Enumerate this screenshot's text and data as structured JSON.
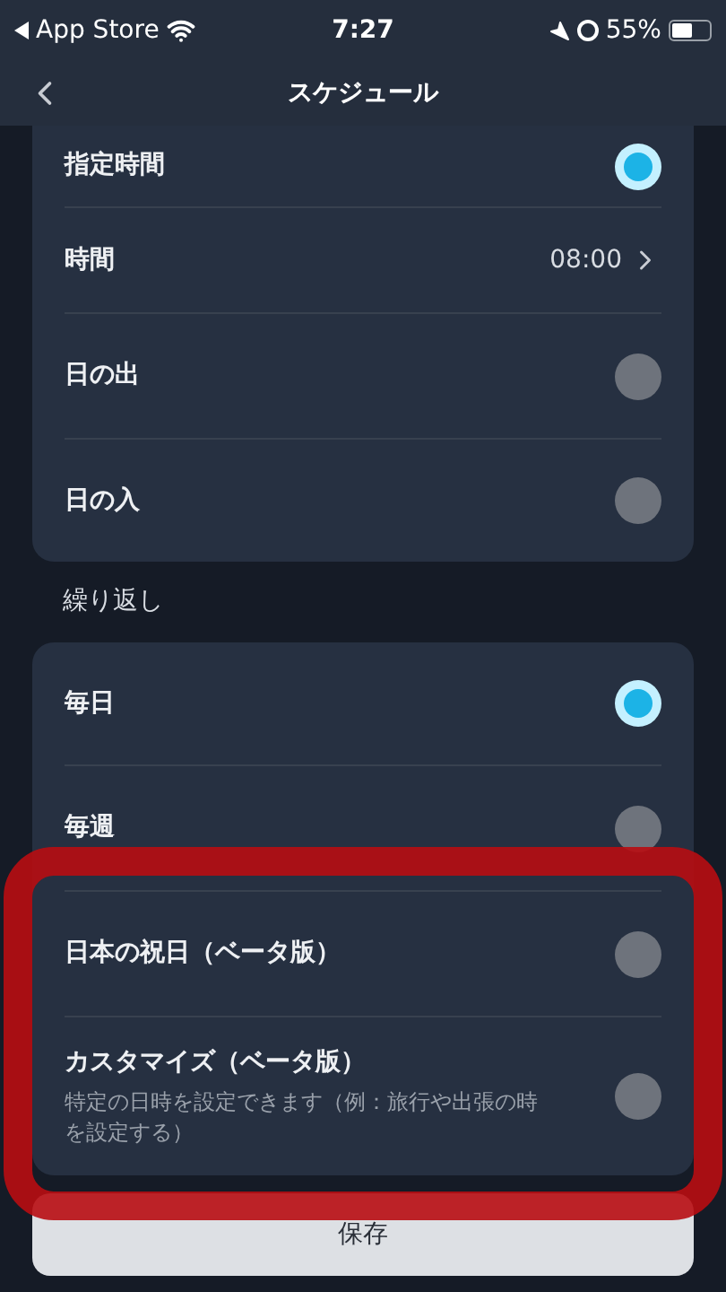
{
  "status_bar": {
    "back_app": "App Store",
    "time": "7:27",
    "battery": "55%"
  },
  "nav_bar": {
    "title": "スケジュール"
  },
  "sections": [
    {
      "items": [
        {
          "kind": "radio",
          "label": "指定時間",
          "selected": true
        },
        {
          "kind": "value",
          "label": "時間",
          "value": "08:00"
        },
        {
          "kind": "radio",
          "label": "日の出",
          "selected": false
        },
        {
          "kind": "radio",
          "label": "日の入",
          "selected": false
        }
      ]
    },
    {
      "header": "繰り返し",
      "items": [
        {
          "kind": "radio",
          "label": "毎日",
          "selected": true
        },
        {
          "kind": "radio",
          "label": "毎週",
          "selected": false
        },
        {
          "kind": "radio",
          "label": "日本の祝日（ベータ版）",
          "selected": false
        },
        {
          "kind": "radio",
          "label": "カスタマイズ（ベータ版）",
          "description": "特定の日時を設定できます（例：旅行や出張の時を設定する）",
          "selected": false
        }
      ]
    }
  ],
  "save_button": "保存",
  "annotation": {
    "kind": "highlight"
  }
}
